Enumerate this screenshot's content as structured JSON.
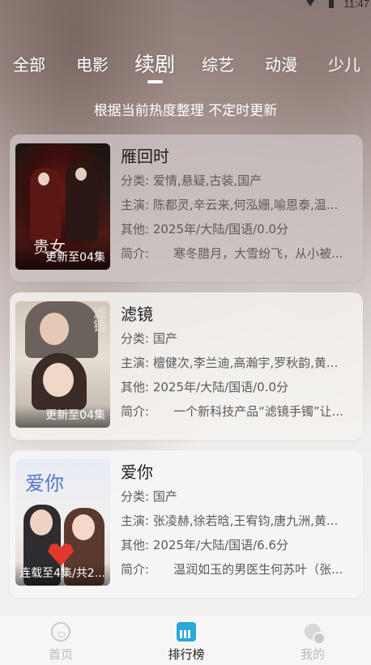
{
  "status_bar": {
    "time": "11:47"
  },
  "tabs": [
    {
      "label": "全部",
      "active": false
    },
    {
      "label": "电影",
      "active": false
    },
    {
      "label": "续剧",
      "active": true
    },
    {
      "label": "综艺",
      "active": false
    },
    {
      "label": "动漫",
      "active": false
    },
    {
      "label": "少儿",
      "active": false
    }
  ],
  "subtitle": "根据当前热度整理 不定时更新",
  "labels": {
    "category": "分类:",
    "cast": "主演:",
    "other": "其他:",
    "intro": "简介:"
  },
  "items": [
    {
      "title": "雁回时",
      "category": "爱情,悬疑,古装,国产",
      "cast": "陈都灵,辛云来,何泓姗,喻恩泰,温...",
      "other": "2025年/大陆/国语/0.0分",
      "intro": "寒冬腊月，大雪纷飞，从小被...",
      "badge": "更新至04集",
      "poster_text": "贵女"
    },
    {
      "title": "滤镜",
      "category": "国产",
      "cast": "檀健次,李兰迪,高瀚宇,罗秋韵,黄...",
      "other": "2025年/大陆/国语/0.0分",
      "intro": "一个新科技产品“滤镜手镯”让...",
      "badge": "更新至04集",
      "poster_text": "滤镜"
    },
    {
      "title": "爱你",
      "category": "国产",
      "cast": "张凌赫,徐若晗,王宥钧,唐九洲,黄...",
      "other": "2025年/大陆/国语/6.6分",
      "intro": "温润如玉的男医生何苏叶（张...",
      "badge": "连载至4集/共2...",
      "poster_text": "爱你"
    }
  ],
  "bottom_nav": [
    {
      "label": "首页",
      "icon": "home-icon",
      "active": false
    },
    {
      "label": "排行榜",
      "icon": "ranking-icon",
      "active": true
    },
    {
      "label": "我的",
      "icon": "profile-icon",
      "active": false
    }
  ],
  "colors": {
    "accent_rank": "#2aa8d8",
    "text_primary": "#1f1f1f",
    "text_secondary": "#5b5b5b"
  }
}
